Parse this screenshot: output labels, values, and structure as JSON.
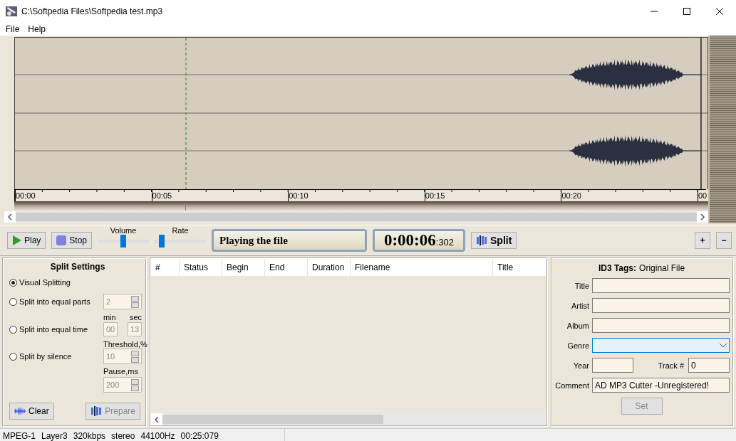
{
  "window": {
    "title": "C:\\Softpedia Files\\Softpedia test.mp3"
  },
  "menu": [
    "File",
    "Help"
  ],
  "ruler_labels": [
    "00:00",
    "00:05",
    "00:10",
    "00:15",
    "00:20",
    "00"
  ],
  "transport": {
    "play": "Play",
    "stop": "Stop",
    "sliders": [
      {
        "label": "Volume",
        "level": 0.5
      },
      {
        "label": "Rate",
        "level": 0.1
      }
    ],
    "status_text": "Playing the file",
    "time_main": "0:00:06",
    "time_ms": ":302",
    "split": "Split",
    "zoom_buttons": [
      "+",
      "−"
    ]
  },
  "split_settings": {
    "title": "Split Settings",
    "options": [
      {
        "label": "Visual Splitting",
        "selected": true
      },
      {
        "label": "Split into equal parts",
        "selected": false
      },
      {
        "label": "Split into equal time",
        "selected": false
      },
      {
        "label": "Split by silence",
        "selected": false
      }
    ],
    "parts": "2",
    "min_label": "min",
    "sec_label": "sec",
    "min": "00",
    "sec": "13",
    "threshold_label": "Threshold,%",
    "threshold": "10",
    "pause_label": "Pause,ms",
    "pause": "200",
    "buttons": [
      {
        "label": "Clear",
        "kind": "clear",
        "disabled": false
      },
      {
        "label": "Prepare",
        "kind": "prepare",
        "disabled": true
      }
    ]
  },
  "table": {
    "columns": [
      "#",
      "Status",
      "Begin",
      "End",
      "Duration",
      "Filename",
      "Title"
    ]
  },
  "id3": {
    "title": "ID3 Tags:",
    "subtitle": "Original File",
    "fields": [
      {
        "label": "Title",
        "kind": "text"
      },
      {
        "label": "Artist",
        "kind": "text"
      },
      {
        "label": "Album",
        "kind": "text"
      },
      {
        "label": "Genre",
        "kind": "dropdown"
      }
    ],
    "year_label": "Year",
    "track_label": "Track #",
    "track": "0",
    "comment_label": "Comment",
    "comment": "AD MP3 Cutter -Unregistered!",
    "set_button": {
      "label": "Set",
      "disabled": true
    }
  },
  "status_bar": [
    "MPEG-1",
    "Layer3",
    "320kbps",
    "stereo",
    "44100Hz",
    "00:25:079"
  ]
}
